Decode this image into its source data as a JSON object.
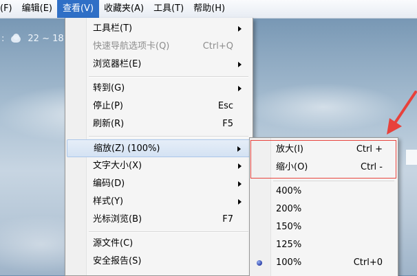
{
  "menubar": {
    "items": [
      {
        "label": "(F)"
      },
      {
        "label": "编辑(E)"
      },
      {
        "label": "查看(V)"
      },
      {
        "label": "收藏夹(A)"
      },
      {
        "label": "工具(T)"
      },
      {
        "label": "帮助(H)"
      }
    ]
  },
  "weather": {
    "prefix": ":",
    "temp": "22 ~ 18°"
  },
  "view_menu": {
    "items": [
      {
        "label": "工具栏(T)",
        "shortcut": ""
      },
      {
        "label": "快速导航选项卡(Q)",
        "shortcut": "Ctrl+Q"
      },
      {
        "label": "浏览器栏(E)",
        "shortcut": ""
      },
      {
        "label": "转到(G)",
        "shortcut": ""
      },
      {
        "label": "停止(P)",
        "shortcut": "Esc"
      },
      {
        "label": "刷新(R)",
        "shortcut": "F5"
      },
      {
        "label": "缩放(Z) (100%)",
        "shortcut": ""
      },
      {
        "label": "文字大小(X)",
        "shortcut": ""
      },
      {
        "label": "编码(D)",
        "shortcut": ""
      },
      {
        "label": "样式(Y)",
        "shortcut": ""
      },
      {
        "label": "光标浏览(B)",
        "shortcut": "F7"
      },
      {
        "label": "源文件(C)",
        "shortcut": ""
      },
      {
        "label": "安全报告(S)",
        "shortcut": ""
      }
    ]
  },
  "zoom_menu": {
    "items": [
      {
        "label": "放大(I)",
        "shortcut": "Ctrl +"
      },
      {
        "label": "缩小(O)",
        "shortcut": "Ctrl -"
      },
      {
        "label": "400%",
        "shortcut": ""
      },
      {
        "label": "200%",
        "shortcut": ""
      },
      {
        "label": "150%",
        "shortcut": ""
      },
      {
        "label": "125%",
        "shortcut": ""
      },
      {
        "label": "100%",
        "shortcut": "Ctrl+0"
      }
    ]
  },
  "colors": {
    "highlight_border": "#e8413b",
    "menubar_active": "#2f6fc6"
  }
}
